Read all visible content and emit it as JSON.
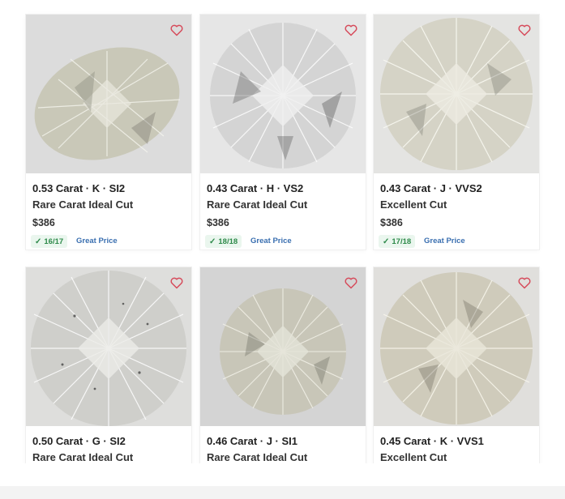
{
  "colors": {
    "heart": "#d64b5b",
    "score_bg": "#eaf6ee",
    "score_text": "#2e8a4a",
    "great_price": "#3a6fb0"
  },
  "cards": [
    {
      "title": "0.53 Carat · K · SI2",
      "cut": "Rare Carat Ideal Cut",
      "price": "$386",
      "score": "16/17",
      "badge": "Great Price",
      "favorite_icon": "heart-icon",
      "diamond_tint": "#c9c8b8"
    },
    {
      "title": "0.43 Carat · H · VS2",
      "cut": "Rare Carat Ideal Cut",
      "price": "$386",
      "score": "18/18",
      "badge": "Great Price",
      "favorite_icon": "heart-icon",
      "diamond_tint": "#d4d4d4"
    },
    {
      "title": "0.43 Carat · J · VVS2",
      "cut": "Excellent Cut",
      "price": "$386",
      "score": "17/18",
      "badge": "Great Price",
      "favorite_icon": "heart-icon",
      "diamond_tint": "#d5d3c6"
    },
    {
      "title": "0.50 Carat · G · SI2",
      "cut": "Rare Carat Ideal Cut",
      "favorite_icon": "heart-icon",
      "diamond_tint": "#cfcfcb"
    },
    {
      "title": "0.46 Carat · J · SI1",
      "cut": "Rare Carat Ideal Cut",
      "favorite_icon": "heart-icon",
      "diamond_tint": "#c8c6b8"
    },
    {
      "title": "0.45 Carat · K · VVS1",
      "cut": "Excellent Cut",
      "favorite_icon": "heart-icon",
      "diamond_tint": "#cfcbbb"
    }
  ]
}
